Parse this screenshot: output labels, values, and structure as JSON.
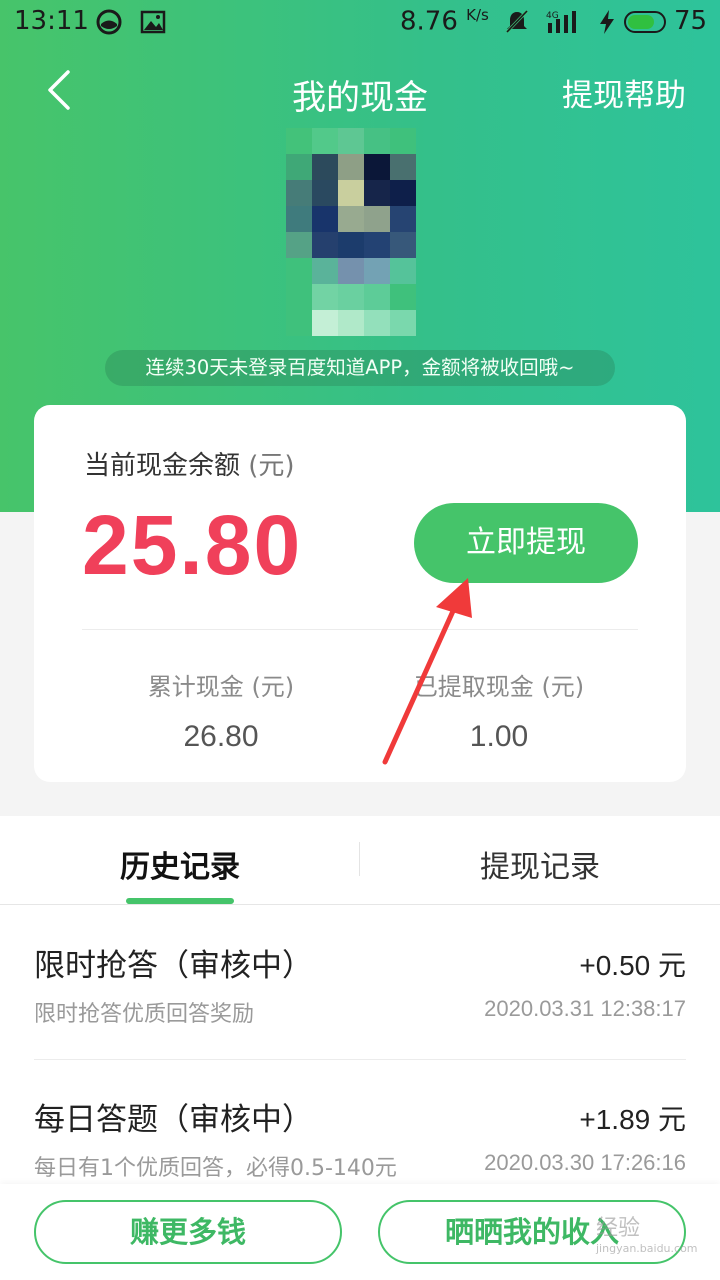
{
  "status_bar": {
    "time": "13:11",
    "net_speed": "8.76",
    "net_unit": "K/s",
    "signal": "4G",
    "battery": "75"
  },
  "header": {
    "title": "我的现金",
    "help_label": "提现帮助",
    "background_colors": [
      "#47c46a",
      "#2ec39b"
    ]
  },
  "notice": "连续30天未登录百度知道APP，金额将被收回哦~",
  "balance_card": {
    "label": "当前现金余额",
    "unit": "(元)",
    "amount": "25.80",
    "withdraw_button": "立即提现",
    "stats": [
      {
        "label": "累计现金 (元)",
        "value": "26.80"
      },
      {
        "label": "已提取现金 (元)",
        "value": "1.00"
      }
    ]
  },
  "tabs": [
    {
      "label": "历史记录",
      "active": true
    },
    {
      "label": "提现记录",
      "active": false
    }
  ],
  "records": [
    {
      "title": "限时抢答（审核中）",
      "amount": "+0.50 元",
      "desc": "限时抢答优质回答奖励",
      "time": "2020.03.31 12:38:17"
    },
    {
      "title": "每日答题（审核中）",
      "amount": "+1.89 元",
      "desc": "每日有1个优质回答，必得0.5-140元",
      "time": "2020.03.30 17:26:16"
    }
  ],
  "bottom_buttons": {
    "earn": "赚更多钱",
    "share": "晒晒我的收入"
  },
  "watermark": {
    "text": "经验",
    "sub": "jingyan.baidu.com"
  },
  "colors": {
    "accent": "#45c46a",
    "amount": "#f0405a",
    "annotation_arrow": "#f03a3a"
  }
}
